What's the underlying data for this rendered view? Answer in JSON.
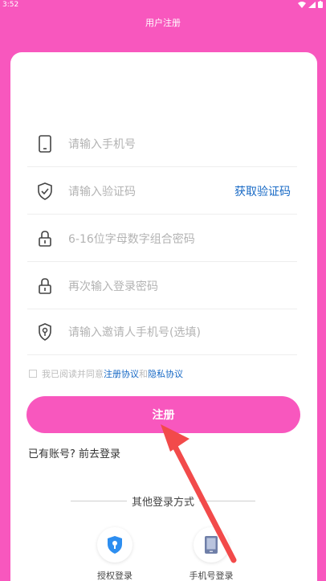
{
  "status_bar": {
    "time": "3:52"
  },
  "header": {
    "title": "用户注册"
  },
  "form": {
    "phone_placeholder": "请输入手机号",
    "code_placeholder": "请输入验证码",
    "get_code_label": "获取验证码",
    "password_placeholder": "6-16位字母数字组合密码",
    "confirm_placeholder": "再次输入登录密码",
    "inviter_placeholder": "请输入邀请人手机号(选填)"
  },
  "agreement": {
    "prefix": "我已阅读并同意",
    "terms": "注册协议",
    "and": "和",
    "privacy": "隐私协议"
  },
  "register_label": "注册",
  "have_account": "已有账号? 前去登录",
  "other_login": {
    "title": "其他登录方式",
    "auth_label": "授权登录",
    "phone_label": "手机号登录"
  },
  "colors": {
    "primary": "#f857be",
    "link": "#1769c5",
    "arrow": "#f24a4a"
  }
}
